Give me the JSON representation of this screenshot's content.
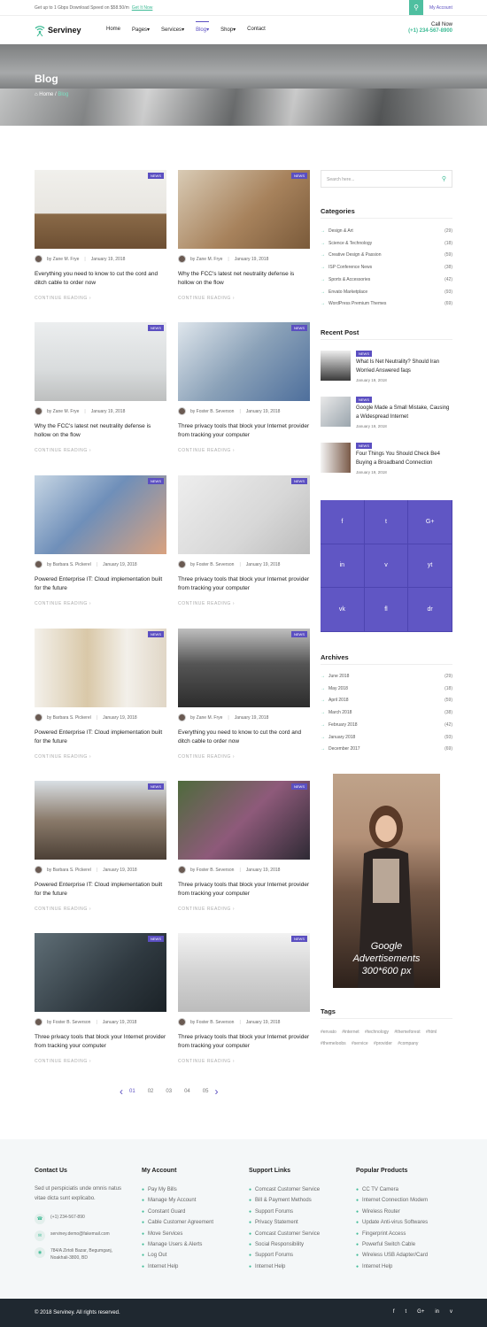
{
  "topbar": {
    "promo": "Get up to 1 Gbps Download Speed on $58.50/m",
    "promo_link": "Get It Now",
    "account": "My Account"
  },
  "header": {
    "brand": "Serviney",
    "nav": [
      "Home",
      "Pages",
      "Services",
      "Blog",
      "Shop",
      "Contact"
    ],
    "call_label": "Call Now",
    "phone": "(+1) 234-567-8900"
  },
  "hero": {
    "title": "Blog",
    "crumb_home": "Home",
    "crumb_sep": "/",
    "crumb_current": "Blog"
  },
  "posts": [
    {
      "badge": "NEWS",
      "author": "by Zane M. Frye",
      "date": "January 19, 2018",
      "title": "Everything you need to know to cut the cord and ditch cable to order now",
      "cta": "CONTINUE READING"
    },
    {
      "badge": "NEWS",
      "author": "by Zane M. Frye",
      "date": "January 19, 2018",
      "title": "Why the FCC's latest net neutrality defense is hollow on the flow",
      "cta": "CONTINUE READING"
    },
    {
      "badge": "NEWS",
      "author": "by Zane M. Frye",
      "date": "January 19, 2018",
      "title": "Why the FCC's latest net neutrality defense is hollow on the flow",
      "cta": "CONTINUE READING"
    },
    {
      "badge": "NEWS",
      "author": "by Foster B. Severson",
      "date": "January 19, 2018",
      "title": "Three privacy tools that block your Internet provider from tracking your computer",
      "cta": "CONTINUE READING"
    },
    {
      "badge": "NEWS",
      "author": "by Barbara S. Pickerel",
      "date": "January 19, 2018",
      "title": "Powered Enterprise IT: Cloud implementation built for the future",
      "cta": "CONTINUE READING"
    },
    {
      "badge": "NEWS",
      "author": "by Foster B. Severson",
      "date": "January 19, 2018",
      "title": "Three privacy tools that block your Internet provider from tracking your computer",
      "cta": "CONTINUE READING"
    },
    {
      "badge": "NEWS",
      "author": "by Barbara S. Pickerel",
      "date": "January 19, 2018",
      "title": "Powered Enterprise IT: Cloud implementation built for the future",
      "cta": "CONTINUE READING"
    },
    {
      "badge": "NEWS",
      "author": "by Zane M. Frye",
      "date": "January 19, 2018",
      "title": "Everything you need to know to cut the cord and ditch cable to order now",
      "cta": "CONTINUE READING"
    },
    {
      "badge": "NEWS",
      "author": "by Barbara S. Pickerel",
      "date": "January 19, 2018",
      "title": "Powered Enterprise IT: Cloud implementation built for the future",
      "cta": "CONTINUE READING"
    },
    {
      "badge": "NEWS",
      "author": "by Foster B. Severson",
      "date": "January 19, 2018",
      "title": "Three privacy tools that block your Internet provider from tracking your computer",
      "cta": "CONTINUE READING"
    },
    {
      "badge": "NEWS",
      "author": "by Foster B. Severson",
      "date": "January 19, 2018",
      "title": "Three privacy tools that block your Internet provider from tracking your computer",
      "cta": "CONTINUE READING"
    },
    {
      "badge": "NEWS",
      "author": "by Foster B. Severson",
      "date": "January 19, 2018",
      "title": "Three privacy tools that block your Internet provider from tracking your computer",
      "cta": "CONTINUE READING"
    }
  ],
  "pagination": {
    "pages": [
      "01",
      "02",
      "03",
      "04",
      "05"
    ],
    "current": "01"
  },
  "sidebar": {
    "search_placeholder": "Search here...",
    "categories_title": "Categories",
    "categories": [
      {
        "name": "Design & Art",
        "count": "(29)"
      },
      {
        "name": "Science & Technology",
        "count": "(18)"
      },
      {
        "name": "Creative Design & Passion",
        "count": "(59)"
      },
      {
        "name": "ISP Conference News",
        "count": "(38)"
      },
      {
        "name": "Sports & Accessories",
        "count": "(42)"
      },
      {
        "name": "Envato Marketplace",
        "count": "(93)"
      },
      {
        "name": "WordPress Premium Themes",
        "count": "(69)"
      }
    ],
    "recent_title": "Recent Post",
    "recent": [
      {
        "badge": "NEWS",
        "title": "What Is Net Neutrality? Should Iran Worried Answered faqs",
        "date": "January 19, 2018"
      },
      {
        "badge": "NEWS",
        "title": "Google Made a Small Mistake, Causing a Widespread Internet",
        "date": "January 19, 2018"
      },
      {
        "badge": "NEWS",
        "title": "Four Things You Should Check Be4 Buying a Broadband Connection",
        "date": "January 19, 2018"
      }
    ],
    "social": [
      "f",
      "t",
      "G+",
      "in",
      "v",
      "yt",
      "vk",
      "fl",
      "dr"
    ],
    "archives_title": "Archives",
    "archives": [
      {
        "name": "June 2018",
        "count": "(29)"
      },
      {
        "name": "May 2018",
        "count": "(18)"
      },
      {
        "name": "April 2018",
        "count": "(59)"
      },
      {
        "name": "March 2018",
        "count": "(38)"
      },
      {
        "name": "February 2018",
        "count": "(42)"
      },
      {
        "name": "January 2018",
        "count": "(93)"
      },
      {
        "name": "December 2017",
        "count": "(69)"
      }
    ],
    "ad": {
      "line1": "Google",
      "line2": "Advertisements",
      "line3": "300*600 px"
    },
    "tags_title": "Tags",
    "tags": [
      "#envato",
      "#internet",
      "#technology",
      "#themeforest",
      "#html",
      "#themeloobs",
      "#service",
      "#provider",
      "#company"
    ]
  },
  "footer": {
    "contact_title": "Contact Us",
    "contact_text": "Sed ut perspiciatis unde omnis natus vitae dicta sunt explicabo.",
    "phone": "(+1) 234-567-890",
    "email": "serviney.demo@fakemail.com",
    "address": "784/A Zirtoli Bazar, Begumganj, Noakhali-3800, BD",
    "account_title": "My Account",
    "account": [
      "Pay My Bills",
      "Manage My Account",
      "Constant Guard",
      "Cable Customer Agreement",
      "Move Services",
      "Manage Users & Alerts",
      "Log Out",
      "Internet Help"
    ],
    "support_title": "Support Links",
    "support": [
      "Comcast Customer Service",
      "Bill & Payment Methods",
      "Support Forums",
      "Privacy Statement",
      "Comcast Customer Service",
      "Social Responsibility",
      "Support Forums",
      "Internet Help"
    ],
    "products_title": "Popular Products",
    "products": [
      "CC TV Camera",
      "Internet Connection Modem",
      "Wireless Router",
      "Update Anti-virus Softwares",
      "Fingerprint Access",
      "Powerful Switch Cable",
      "Wireless USB Adapter/Card",
      "Internet Help"
    ],
    "copyright": "© 2018 Serviney. All rights reserved.",
    "social": [
      "f",
      "t",
      "G+",
      "in",
      "v"
    ]
  },
  "colors": {
    "accent": "#5b4fc1",
    "green": "#3dbb95",
    "dark": "#1f2830"
  }
}
